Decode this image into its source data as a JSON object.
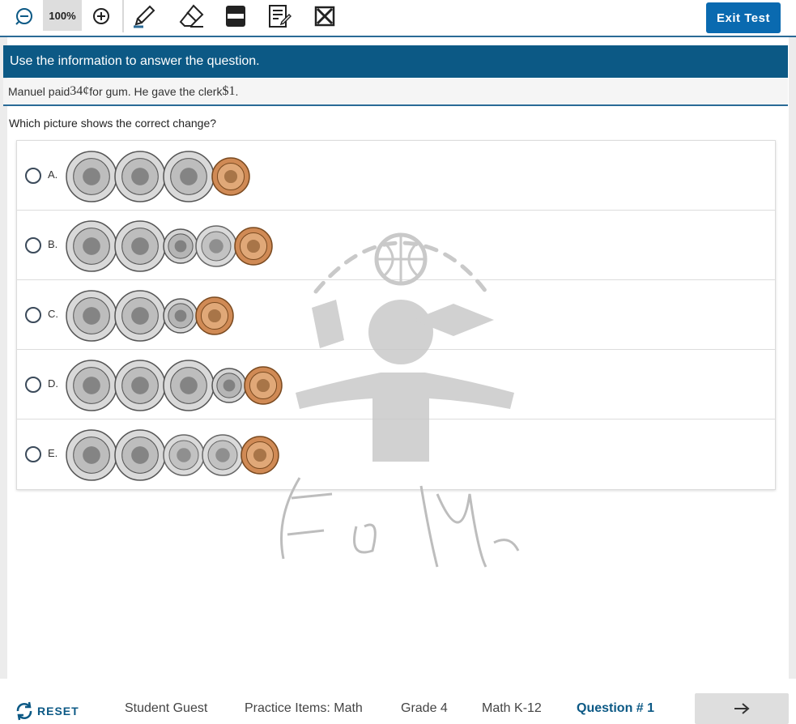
{
  "toolbar": {
    "zoom_level": "100%",
    "tools": [
      "highlighter-icon",
      "eraser-icon",
      "line-reader-icon",
      "notepad-icon",
      "strikethrough-icon"
    ],
    "exit_label": "Exit Test"
  },
  "passage": {
    "banner": "Use the information to answer the question.",
    "stimulus_pre": "Manuel paid ",
    "stimulus_amount": "34¢",
    "stimulus_mid": " for gum. He gave the clerk ",
    "stimulus_paid": "$1",
    "stimulus_end": "."
  },
  "question": {
    "prompt": "Which picture shows the correct change?",
    "choices": [
      {
        "letter": "A.",
        "coins": [
          "quarter",
          "quarter",
          "quarter",
          "penny"
        ]
      },
      {
        "letter": "B.",
        "coins": [
          "quarter",
          "quarter",
          "dime",
          "nickel",
          "penny"
        ]
      },
      {
        "letter": "C.",
        "coins": [
          "quarter",
          "quarter",
          "dime",
          "penny"
        ]
      },
      {
        "letter": "D.",
        "coins": [
          "quarter",
          "quarter",
          "quarter",
          "dime",
          "penny"
        ]
      },
      {
        "letter": "E.",
        "coins": [
          "quarter",
          "quarter",
          "nickel",
          "nickel",
          "penny"
        ]
      }
    ]
  },
  "footer": {
    "reset_label": "RESET",
    "student": "Student Guest",
    "test_name": "Practice Items: Math",
    "grade": "Grade 4",
    "subject": "Math K-12",
    "question_number": "Question # 1"
  },
  "colors": {
    "accent": "#0c5985",
    "button": "#0a6ab0",
    "rule": "#2a6a96"
  }
}
